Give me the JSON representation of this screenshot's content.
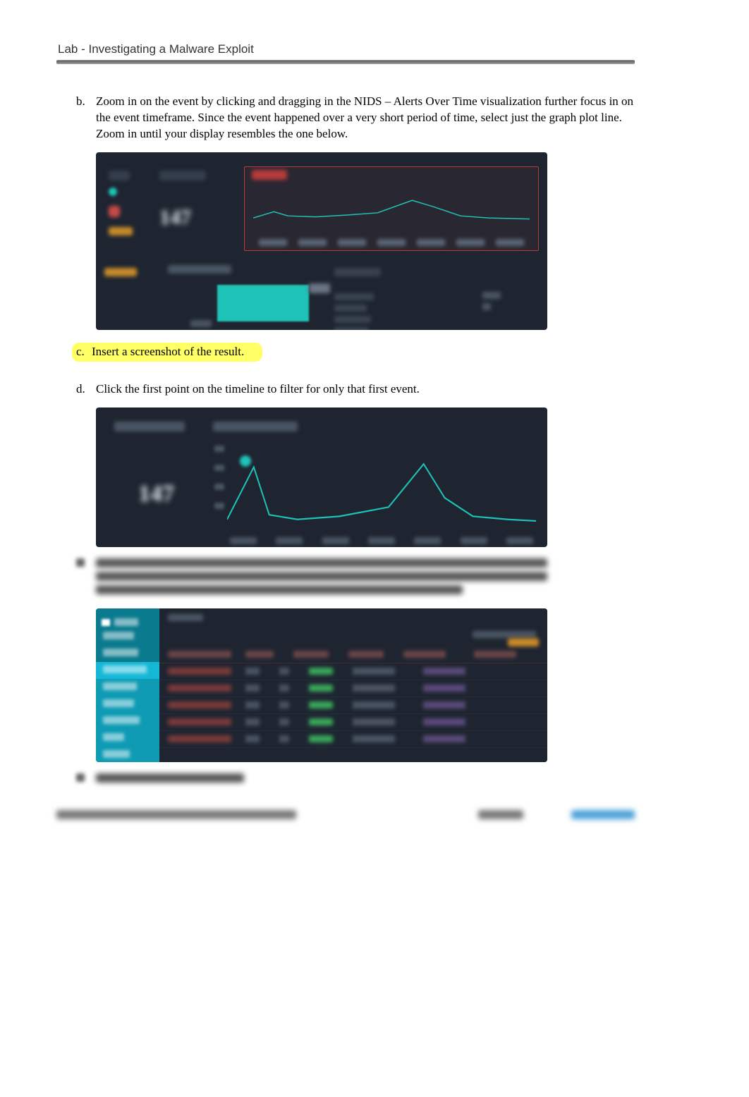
{
  "header": {
    "title": "Lab - Investigating a Malware Exploit"
  },
  "steps": {
    "b": {
      "marker": "b.",
      "text": "Zoom in on the event by clicking and dragging in the NIDS – Alerts Over Time visualization further focus in on the event timeframe. Since the event happened over a very short period of time, select just the graph plot line. Zoom in until your display resembles the one below."
    },
    "c": {
      "marker": "c.",
      "text": "Insert a screenshot of the result."
    },
    "d": {
      "marker": "d.",
      "text": "Click the first point on the timeline to filter for only that first event."
    }
  }
}
